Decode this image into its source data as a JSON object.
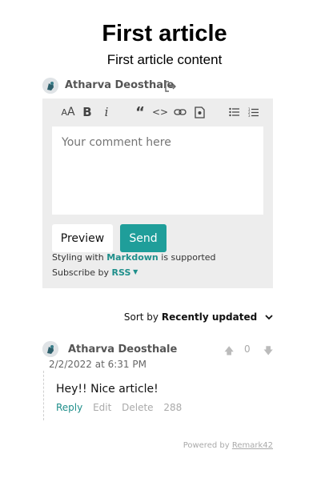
{
  "article": {
    "title": "First article",
    "content": "First article content"
  },
  "current_user": {
    "name": "Atharva Deosthale"
  },
  "editor": {
    "toolbar": [
      "header-icon",
      "bold-icon",
      "italic-icon",
      "quote-icon",
      "code-icon",
      "link-icon",
      "image-icon",
      "unordered-list-icon",
      "ordered-list-icon"
    ],
    "placeholder": "Your comment here",
    "preview_label": "Preview",
    "send_label": "Send",
    "hint_prefix": "Styling with",
    "hint_link": "Markdown",
    "hint_suffix": "is supported",
    "subscribe_prefix": "Subscribe by",
    "subscribe_link": "RSS"
  },
  "sort": {
    "label": "Sort by",
    "value": "Recently updated"
  },
  "comments": [
    {
      "author": "Atharva Deosthale",
      "date": "2/2/2022 at 6:31 PM",
      "text": "Hey!! Nice article!",
      "score": "0",
      "actions": {
        "reply": "Reply",
        "edit": "Edit",
        "delete": "Delete",
        "countdown": "288"
      }
    }
  ],
  "footer": {
    "prefix": "Powered by",
    "link": "Remark42"
  },
  "colors": {
    "accent": "#1f9e9a",
    "editor_bg": "#ededed"
  }
}
